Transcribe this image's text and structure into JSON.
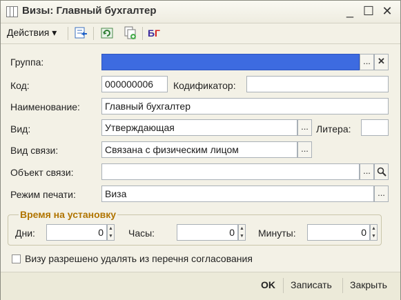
{
  "window": {
    "title": "Визы: Главный бухгалтер"
  },
  "toolbar": {
    "actions_label": "Действия ▾"
  },
  "form": {
    "group_label": "Группа:",
    "group_value": "",
    "code_label": "Код:",
    "code_value": "000000006",
    "codifier_label": "Кодификатор:",
    "codifier_value": "",
    "name_label": "Наименование:",
    "name_value": "Главный бухгалтер",
    "type_label": "Вид:",
    "type_value": "Утверждающая",
    "letter_label": "Литера:",
    "letter_value": "",
    "link_type_label": "Вид связи:",
    "link_type_value": "Связана с физическим лицом",
    "link_object_label": "Объект связи:",
    "link_object_value": "",
    "print_mode_label": "Режим печати:",
    "print_mode_value": "Виза"
  },
  "install_time": {
    "legend": "Время на установку",
    "days_label": "Дни:",
    "days_value": "0",
    "hours_label": "Часы:",
    "hours_value": "0",
    "minutes_label": "Минуты:",
    "minutes_value": "0"
  },
  "checkbox": {
    "label": "Визу разрешено удалять из перечня согласования",
    "checked": false
  },
  "buttons": {
    "ok": "OK",
    "save": "Записать",
    "close": "Закрыть"
  },
  "colors": {
    "selection": "#3d6be0",
    "legend": "#b07400"
  }
}
